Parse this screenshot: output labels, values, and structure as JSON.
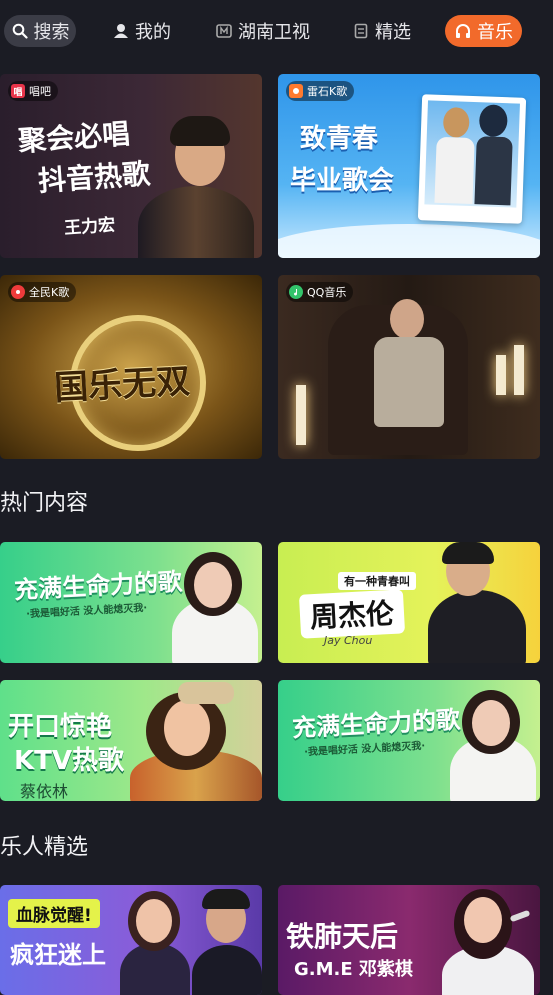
{
  "nav": {
    "search": "搜索",
    "mine": "我的",
    "hunan": "湖南卫视",
    "featured": "精选",
    "music": "音乐"
  },
  "banners": [
    {
      "tag": "唱吧",
      "tag_icon": "唱",
      "line1": "聚会必唱",
      "line2": "抖音热歌",
      "artist": "王力宏"
    },
    {
      "tag": "雷石K歌",
      "line1": "致青春",
      "line2": "毕业歌会"
    },
    {
      "tag": "全民K歌",
      "line1": "国乐无双"
    },
    {
      "tag": "QQ音乐"
    }
  ],
  "section_hot": {
    "title": "热门内容",
    "cards": [
      {
        "line1": "充满生命力的歌",
        "line2": "·我是唱好活 没人能熄灭我·"
      },
      {
        "pre": "有一种青春叫",
        "name": "周杰伦",
        "en": "Jay Chou"
      },
      {
        "line1": "开口惊艳",
        "line2": "KTV热歌",
        "artist": "蔡依林"
      },
      {
        "line1": "充满生命力的歌",
        "line2": "·我是唱好活 没人能熄灭我·"
      }
    ]
  },
  "section_artists": {
    "title": "乐人精选",
    "cards": [
      {
        "badge": "血脉觉醒!",
        "line1": "疯狂迷上"
      },
      {
        "line1": "铁肺天后",
        "line2": "G.M.E 邓紫棋"
      }
    ]
  },
  "colors": {
    "background": "#1b1c24",
    "music_tab": "#f26a2b",
    "search_tab": "#3b3c46"
  },
  "icons": [
    "search-icon",
    "user-icon",
    "tv-icon",
    "bookmark-icon",
    "headphones-icon"
  ]
}
